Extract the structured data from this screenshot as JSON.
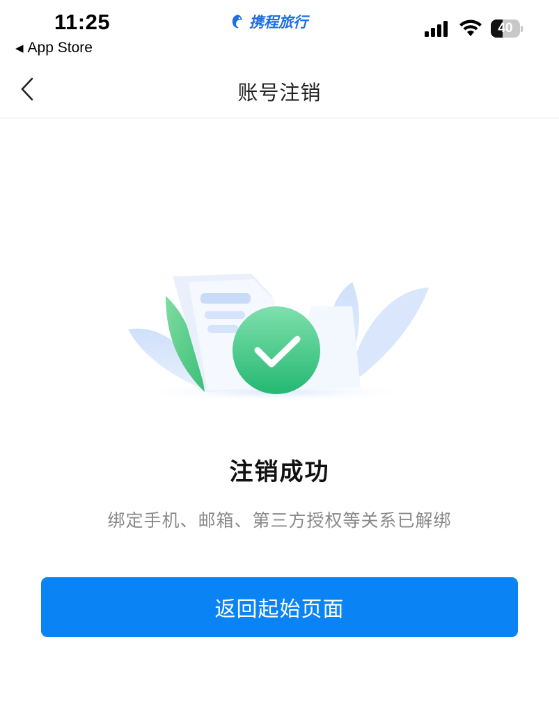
{
  "status_bar": {
    "time": "11:25",
    "back_app_label": "App Store",
    "brand_name": "携程旅行",
    "battery_level": "40",
    "battery_fraction": 0.4
  },
  "nav": {
    "title": "账号注销",
    "back_icon": "chevron-left-icon"
  },
  "result": {
    "title": "注销成功",
    "description": "绑定手机、邮箱、第三方授权等关系已解绑"
  },
  "actions": {
    "return_label": "返回起始页面"
  },
  "colors": {
    "primary": "#0a84f5",
    "success_green": "#2fc27f",
    "brand_blue": "#1f6fe0"
  }
}
